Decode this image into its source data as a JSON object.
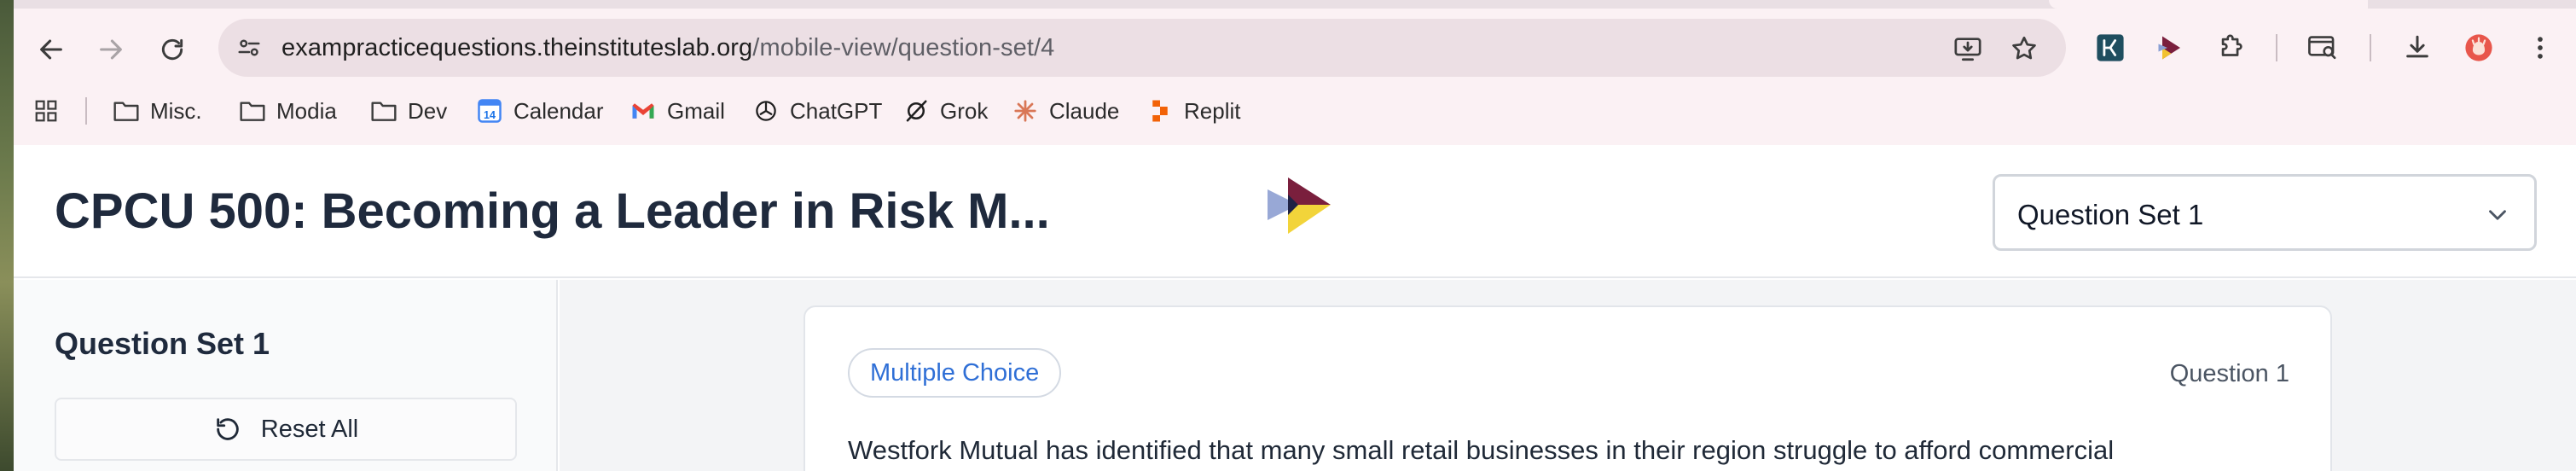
{
  "browser": {
    "url_domain": "exampracticequestions.theinstituteslab.org",
    "url_path": "/mobile-view/question-set/4"
  },
  "bookmarks": [
    {
      "label": "Misc.",
      "icon": "folder-icon"
    },
    {
      "label": "Modia",
      "icon": "folder-icon"
    },
    {
      "label": "Dev",
      "icon": "folder-icon"
    },
    {
      "label": "Calendar",
      "icon": "calendar-icon"
    },
    {
      "label": "Gmail",
      "icon": "gmail-icon"
    },
    {
      "label": "ChatGPT",
      "icon": "chatgpt-icon"
    },
    {
      "label": "Grok",
      "icon": "grok-icon"
    },
    {
      "label": "Claude",
      "icon": "claude-icon"
    },
    {
      "label": "Replit",
      "icon": "replit-icon"
    }
  ],
  "calendar_icon_text": "14",
  "header": {
    "title": "CPCU 500: Becoming a Leader in Risk M...",
    "selected_set": "Question Set 1"
  },
  "sidebar": {
    "title": "Question Set 1",
    "reset_label": "Reset All"
  },
  "question": {
    "type_badge": "Multiple Choice",
    "number_label": "Question 1",
    "text": "Westfork Mutual has identified that many small retail businesses in their region struggle to afford commercial"
  },
  "colors": {
    "accent_blue": "#2f6fd6",
    "title_navy": "#1f2a3d",
    "chrome_pink": "#fbf1f4"
  }
}
